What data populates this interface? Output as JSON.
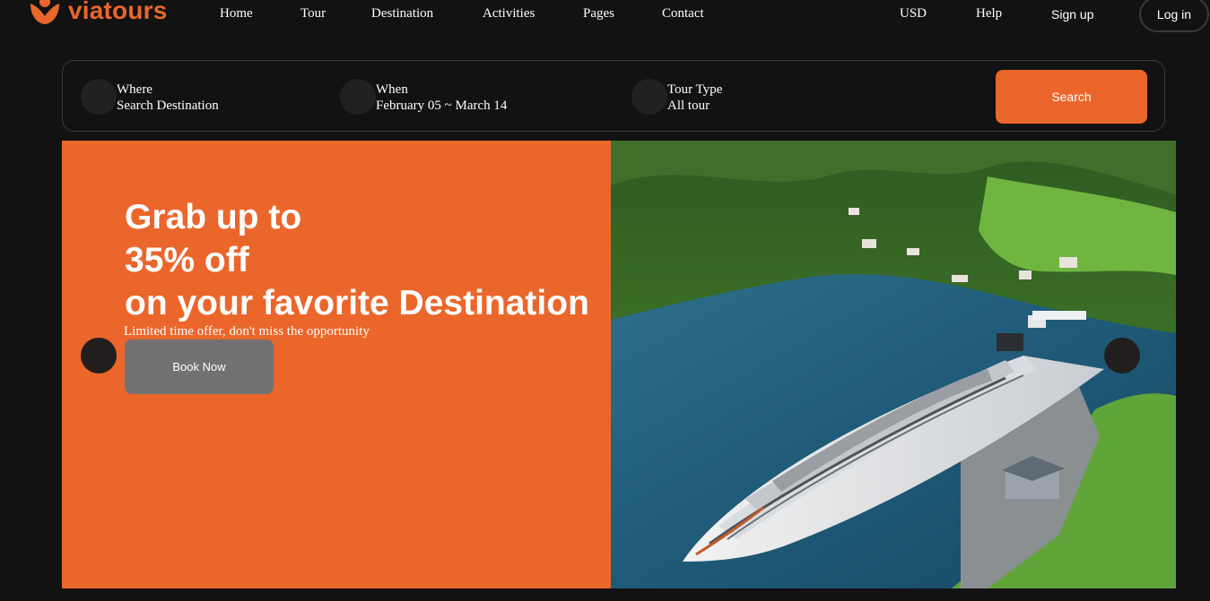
{
  "brand": {
    "name": "viatours",
    "color": "#eb662b",
    "icon": "viatours-logo-icon"
  },
  "nav": {
    "items": [
      "Home",
      "Tour",
      "Destination",
      "Activities",
      "Pages",
      "Contact"
    ],
    "currency": "USD",
    "help": "Help",
    "signup": "Sign up",
    "login": "Log in"
  },
  "search": {
    "fields": [
      {
        "label": "Where",
        "value": "Search Destination",
        "icon": "location-icon"
      },
      {
        "label": "When",
        "value": "February 05 ~ March 14",
        "icon": "calendar-icon"
      },
      {
        "label": "Tour Type",
        "value": "All tour",
        "icon": "tour-type-icon"
      }
    ],
    "button": "Search"
  },
  "hero": {
    "title_lines": [
      "Grab up to",
      "35% off",
      "on your favorite Destination"
    ],
    "subtitle": "Limited time offer, don't miss the opportunity",
    "cta": "Book Now",
    "image": "cruise-ship-fjord-photo",
    "prev_icon": "prev-arrow-icon",
    "next_icon": "next-arrow-icon"
  },
  "colors": {
    "accent": "#eb662b",
    "background": "#121212",
    "button_gray": "#727272"
  }
}
